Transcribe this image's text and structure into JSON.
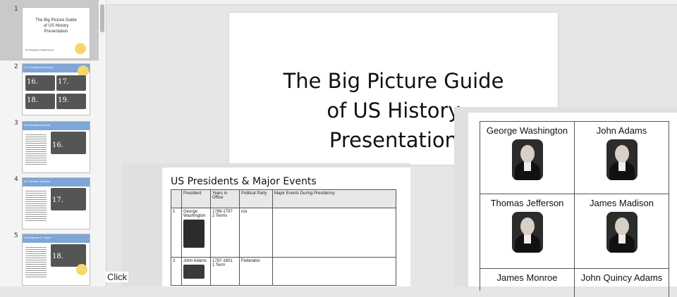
{
  "slides_panel": {
    "thumbnails": [
      {
        "number": "1",
        "title_lines": [
          "The Big Picture Guide",
          "of US History",
          "Presentation"
        ],
        "footer": "US Presidents & Major Events"
      },
      {
        "number": "2",
        "title": "U.S. Presidents Review",
        "labels": [
          "16.",
          "17.",
          "18.",
          "19."
        ]
      },
      {
        "number": "3",
        "title": "#16 Abraham Lincoln",
        "label": "16."
      },
      {
        "number": "4",
        "title": "#17 Andrew Johnson",
        "label": "17."
      },
      {
        "number": "5",
        "title": "#18 Ulysses S. Grant",
        "label": "18."
      }
    ]
  },
  "main_slide": {
    "title_lines": [
      "The Big Picture Guide",
      "of US History",
      "Presentation"
    ]
  },
  "events_table": {
    "heading": "US Presidents & Major Events",
    "columns": [
      "",
      "President",
      "Years in Office",
      "Political Party",
      "Major Events During Presidency"
    ],
    "rows": [
      {
        "num": "1",
        "president": "George Washington",
        "years": "1789-1797\n2 Terms",
        "party": "n/a",
        "events": ""
      },
      {
        "num": "2",
        "president": "John Adams",
        "years": "1797-1801\n1 Term",
        "party": "Federalist",
        "events": ""
      }
    ]
  },
  "portraits": {
    "names": [
      "George Washington",
      "John Adams",
      "Thomas Jefferson",
      "James Madison",
      "James Monroe",
      "John Quincy Adams"
    ]
  },
  "bottom_hint": "Click"
}
